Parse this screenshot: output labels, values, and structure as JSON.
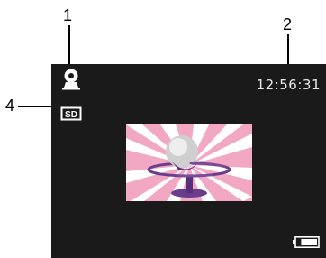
{
  "callouts": {
    "one": "1",
    "two": "2",
    "four": "4"
  },
  "screen": {
    "time": "12:56:31",
    "sd_label": "SD",
    "icons": {
      "top_left": "webcam-icon",
      "left": "sd-card-icon",
      "center": "microphone-illustration",
      "bottom_right": "battery-icon"
    },
    "battery_level": 0.8
  },
  "colors": {
    "screen_bg": "#1a1a1a",
    "clock_text": "#e8e8e8",
    "illustration_pink": "#f2a7c3",
    "illustration_white": "#ffffff",
    "mic_purple": "#6a3d8c"
  }
}
